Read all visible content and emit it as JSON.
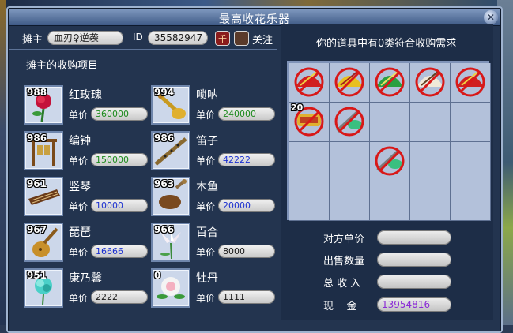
{
  "window": {
    "title": "最高收花乐器",
    "close_glyph": "✕"
  },
  "header": {
    "stall_owner_label": "摊主",
    "stall_owner_name": "血刃♀逆袭",
    "id_label": "ID",
    "id_value": "35582947",
    "follow_label": "关注"
  },
  "left": {
    "section_title": "摊主的收购项目",
    "price_label": "单价",
    "items": [
      {
        "name": "红玫瑰",
        "count": "988",
        "price": "360000",
        "price_color": "#1c8a1c",
        "icon": "rose-icon"
      },
      {
        "name": "唢呐",
        "count": "994",
        "price": "240000",
        "price_color": "#1c8a1c",
        "icon": "suona-icon"
      },
      {
        "name": "编钟",
        "count": "986",
        "price": "150000",
        "price_color": "#1c8a1c",
        "icon": "bell-chime-icon"
      },
      {
        "name": "笛子",
        "count": "986",
        "price": "42222",
        "price_color": "#1a2fd0",
        "icon": "flute-icon"
      },
      {
        "name": "竖琴",
        "count": "961",
        "price": "10000",
        "price_color": "#1a2fd0",
        "icon": "zither-icon"
      },
      {
        "name": "木鱼",
        "count": "963",
        "price": "20000",
        "price_color": "#1a2fd0",
        "icon": "wooden-fish-icon"
      },
      {
        "name": "琵琶",
        "count": "967",
        "price": "16666",
        "price_color": "#1a2fd0",
        "icon": "pipa-icon"
      },
      {
        "name": "百合",
        "count": "966",
        "price": "8000",
        "price_color": "#1a1a1a",
        "icon": "lily-icon"
      },
      {
        "name": "康乃馨",
        "count": "951",
        "price": "2222",
        "price_color": "#1a1a1a",
        "icon": "carnation-icon"
      },
      {
        "name": "牡丹",
        "count": "0",
        "price": "1111",
        "price_color": "#1a1a1a",
        "icon": "peony-icon"
      }
    ]
  },
  "right": {
    "heading": "你的道具中有0类符合收购需求",
    "grid_items": [
      {
        "icon": "red-fan-disabled-icon",
        "count": ""
      },
      {
        "icon": "gold-fan-disabled-icon",
        "count": ""
      },
      {
        "icon": "green-fan-disabled-icon",
        "count": ""
      },
      {
        "icon": "white-fan-disabled-icon",
        "count": ""
      },
      {
        "icon": "red-fan-disabled-icon",
        "count": ""
      },
      {
        "icon": "firecracker-disabled-icon",
        "count": "20"
      },
      {
        "icon": "jade-disabled-icon",
        "count": ""
      },
      {
        "icon": "jade-disabled-icon",
        "count": ""
      }
    ],
    "form": {
      "unit_price_label": "对方单价",
      "unit_price_value": "",
      "sell_qty_label": "出售数量",
      "sell_qty_value": "",
      "total_income_label": "总 收 入",
      "total_income_value": "",
      "cash_label": "现    金",
      "cash_value": "13954816"
    }
  }
}
